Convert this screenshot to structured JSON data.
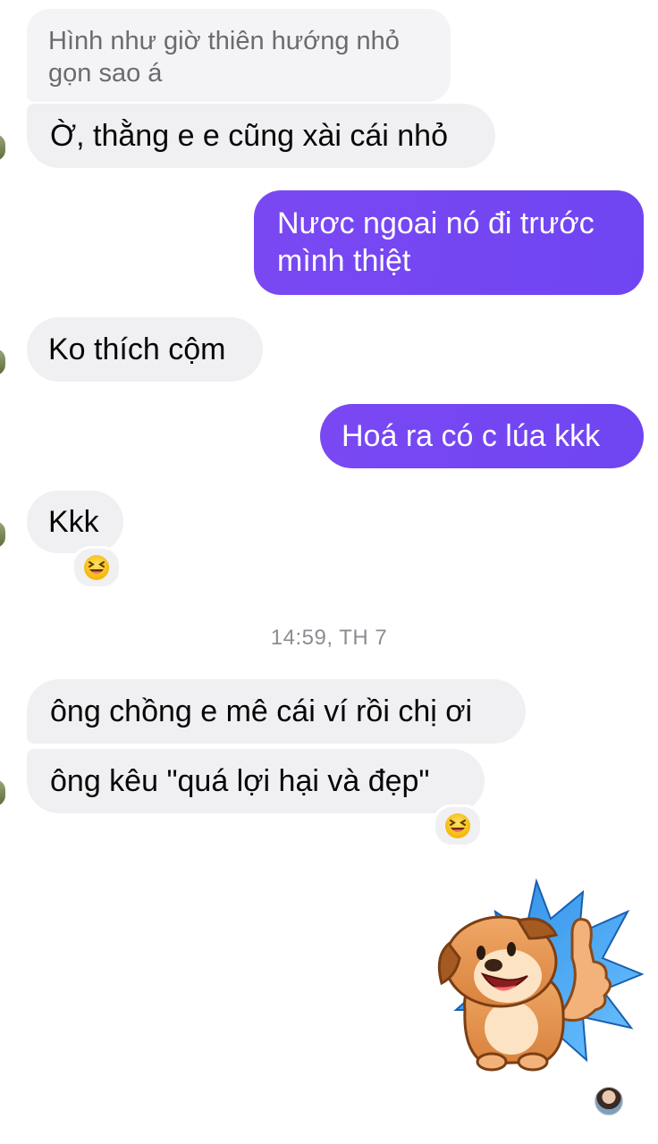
{
  "messages": [
    {
      "id": "m1",
      "side": "in",
      "text": "Hình như giờ thiên hướng nhỏ gọn sao á",
      "line1": "Hình như giờ thiên hướng nhỏ",
      "line2": "gọn sao á"
    },
    {
      "id": "m2",
      "side": "in",
      "text": "Ờ, thằng e e cũng xài cái nhỏ"
    },
    {
      "id": "m3",
      "side": "out",
      "line1": "Nươc ngoai nó đi trước",
      "line2": "mình thiệt"
    },
    {
      "id": "m4",
      "side": "in",
      "text": "Ko thích cộm"
    },
    {
      "id": "m5",
      "side": "out",
      "text": "Hoá ra có c lúa kkk"
    },
    {
      "id": "m6",
      "side": "in",
      "text": "Kkk",
      "reaction": "laughing-emoji"
    },
    {
      "id": "m7",
      "side": "in",
      "text": "ông chồng e mê cái ví rồi chị ơi"
    },
    {
      "id": "m8",
      "side": "in",
      "text": "ông kêu \"quá lợi hại và đẹp\"",
      "reaction": "laughing-emoji"
    }
  ],
  "timestamp": "14:59, TH 7",
  "sticker": "dog-thumbs-up-sticker",
  "colors": {
    "outgoing": "#7a48f3",
    "incoming": "#f0f0f2",
    "timestamp": "#8a8d91"
  }
}
